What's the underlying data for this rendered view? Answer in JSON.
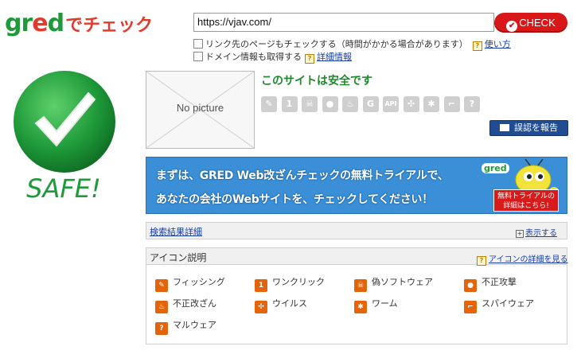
{
  "logo": {
    "brand_prefix": "gr",
    "brand_e": "e",
    "brand_suffix": "d",
    "tagline": "でチェック"
  },
  "search": {
    "url_value": "https://vjav.com/",
    "check_label": "CHECK"
  },
  "options": {
    "link_check_label": "リンク先のページもチェックする（時間がかかる場合があります）",
    "usage_link": "使い方",
    "domain_info_label": "ドメイン情報も取得する",
    "detail_link": "詳細情報"
  },
  "result": {
    "safe_label": "SAFE!",
    "thumbnail_text": "No picture",
    "safe_message": "このサイトは安全です",
    "report_label": "誤認を報告",
    "threat_icons": [
      "phishing-icon",
      "one-click-icon",
      "fake-software-icon",
      "attack-icon",
      "defacement-icon",
      "g-icon",
      "api-icon",
      "virus-icon",
      "worm-icon",
      "spyware-icon",
      "malware-icon"
    ],
    "threat_icon_glyphs": [
      "✎",
      "1",
      "☠",
      "●",
      "♨",
      "G",
      "API",
      "✣",
      "✱",
      "⌐",
      "?"
    ]
  },
  "banner": {
    "line1": "まずは、GRED Web改ざんチェックの無料トライアルで、",
    "line2": "あなたの会社のWebサイトを、チェックしてください！",
    "brand": "gred",
    "cta": "無料トライアルの詳細はこちら!"
  },
  "details": {
    "title": "検索結果詳細",
    "show_label": "表示する"
  },
  "icon_legend": {
    "title": "アイコン説明",
    "detail_link": "アイコンの詳細を見る",
    "items": [
      {
        "label": "フィッシング",
        "glyph": "✎",
        "icon": "phishing-icon"
      },
      {
        "label": "ワンクリック",
        "glyph": "1",
        "icon": "one-click-icon"
      },
      {
        "label": "偽ソフトウェア",
        "glyph": "☠",
        "icon": "fake-software-icon"
      },
      {
        "label": "不正攻撃",
        "glyph": "●",
        "icon": "attack-icon"
      },
      {
        "label": "不正改ざん",
        "glyph": "♨",
        "icon": "defacement-icon"
      },
      {
        "label": "ウイルス",
        "glyph": "✣",
        "icon": "virus-icon"
      },
      {
        "label": "ワーム",
        "glyph": "✱",
        "icon": "worm-icon"
      },
      {
        "label": "スパイウェア",
        "glyph": "⌐",
        "icon": "spyware-icon"
      },
      {
        "label": "マルウェア",
        "glyph": "?",
        "icon": "malware-icon"
      }
    ]
  },
  "colors": {
    "safe_green": "#1f9a3a",
    "check_red": "#d71718",
    "banner_blue": "#3a8fd6",
    "icon_orange": "#e5640a"
  }
}
